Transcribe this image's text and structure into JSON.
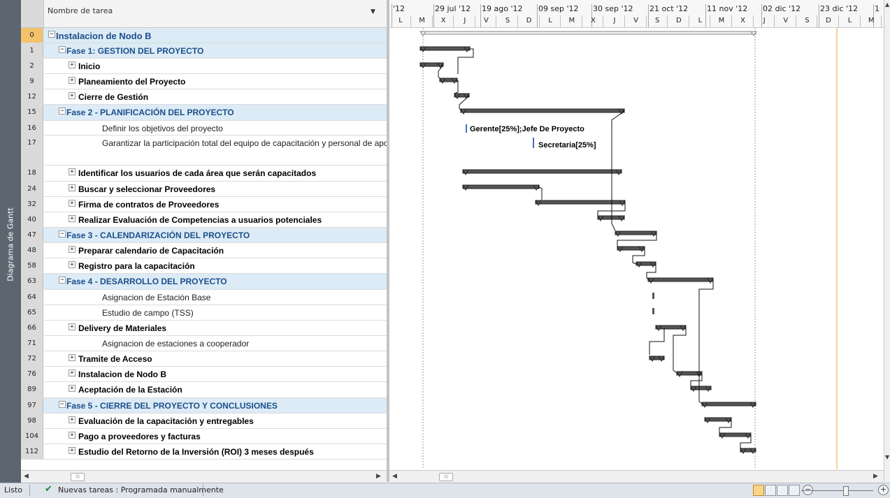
{
  "viewbar": {
    "label": "Diagrama de Gantt"
  },
  "table": {
    "column_header": "Nombre de tarea",
    "rows": [
      {
        "id": "0",
        "name": "Instalacion de Nodo B",
        "kind": "root",
        "toggle": "−",
        "selected": true
      },
      {
        "id": "1",
        "name": "Fase 1: GESTION DEL PROYECTO",
        "kind": "summary",
        "toggle": "−"
      },
      {
        "id": "2",
        "name": "Inicio",
        "kind": "sub",
        "toggle": "+"
      },
      {
        "id": "9",
        "name": "Planeamiento del Proyecto",
        "kind": "sub",
        "toggle": "+"
      },
      {
        "id": "12",
        "name": "Cierre de Gestión",
        "kind": "sub",
        "toggle": "+"
      },
      {
        "id": "15",
        "name": "Fase 2 - PLANIFICACIÓN DEL PROYECTO",
        "kind": "summary",
        "toggle": "−"
      },
      {
        "id": "16",
        "name": "Definir los objetivos del proyecto",
        "kind": "task",
        "toggle": ""
      },
      {
        "id": "17",
        "name": "Garantizar la participación total del equipo de capacitación y personal de apoyo",
        "kind": "task",
        "toggle": "",
        "tall": true
      },
      {
        "id": "18",
        "name": "Identificar los usuarios de cada área que serán capacitados",
        "kind": "sub",
        "toggle": "+"
      },
      {
        "id": "24",
        "name": "Buscar y seleccionar Proveedores",
        "kind": "sub",
        "toggle": "+"
      },
      {
        "id": "32",
        "name": "Firma de contratos de Proveedores",
        "kind": "sub",
        "toggle": "+"
      },
      {
        "id": "40",
        "name": "Realizar Evaluación de Competencias a usuarios potenciales",
        "kind": "sub",
        "toggle": "+"
      },
      {
        "id": "47",
        "name": "Fase 3 - CALENDARIZACIÓN DEL PROYECTO",
        "kind": "summary",
        "toggle": "−"
      },
      {
        "id": "48",
        "name": "Preparar calendario de Capacitación",
        "kind": "sub",
        "toggle": "+"
      },
      {
        "id": "58",
        "name": "Registro para la capacitación",
        "kind": "sub",
        "toggle": "+"
      },
      {
        "id": "63",
        "name": "Fase 4 - DESARROLLO DEL PROYECTO",
        "kind": "summary",
        "toggle": "−"
      },
      {
        "id": "64",
        "name": "Asignacion de Estación Base",
        "kind": "task",
        "toggle": ""
      },
      {
        "id": "65",
        "name": "Estudio de campo (TSS)",
        "kind": "task",
        "toggle": ""
      },
      {
        "id": "66",
        "name": "Delivery de Materiales",
        "kind": "sub",
        "toggle": "+"
      },
      {
        "id": "71",
        "name": "Asignacion de estaciones a cooperador",
        "kind": "task",
        "toggle": ""
      },
      {
        "id": "72",
        "name": "Tramite de Acceso",
        "kind": "sub",
        "toggle": "+"
      },
      {
        "id": "76",
        "name": "Instalacion de Nodo B",
        "kind": "sub",
        "toggle": "+"
      },
      {
        "id": "89",
        "name": "Aceptación de la Estación",
        "kind": "sub",
        "toggle": "+"
      },
      {
        "id": "97",
        "name": "Fase 5 - CIERRE DEL PROYECTO Y CONCLUSIONES",
        "kind": "summary",
        "toggle": "−"
      },
      {
        "id": "98",
        "name": "Evaluación de la capacitación y entregables",
        "kind": "sub",
        "toggle": "+"
      },
      {
        "id": "104",
        "name": "Pago a proveedores y facturas",
        "kind": "sub",
        "toggle": "+"
      },
      {
        "id": "112",
        "name": "Estudio del Retorno de la Inversión (ROI) 3 meses después",
        "kind": "sub",
        "toggle": "+"
      }
    ]
  },
  "timescale": {
    "weeks": [
      "'12",
      "29 jul '12",
      "19 ago '12",
      "09 sep '12",
      "30 sep '12",
      "21 oct '12",
      "11 nov '12",
      "02 dic '12",
      "23 dic '12",
      "1"
    ],
    "days": [
      "L",
      "M",
      "X",
      "J",
      "V",
      "S",
      "D",
      "L",
      "M",
      "X",
      "J",
      "V",
      "S",
      "D",
      "L",
      "M",
      "X",
      "J",
      "V",
      "S",
      "D",
      "L",
      "M"
    ]
  },
  "gantt": {
    "resource_labels": [
      "Gerente[25%];Jefe De Proyecto",
      "Secretaria[25%]"
    ],
    "bar_color": "#555555",
    "summary_color": "#c8c8c8",
    "today_line_color": "#f0a040"
  },
  "statusbar": {
    "ready": "Listo",
    "new_tasks": "Nuevas tareas : Programada manualmente"
  }
}
